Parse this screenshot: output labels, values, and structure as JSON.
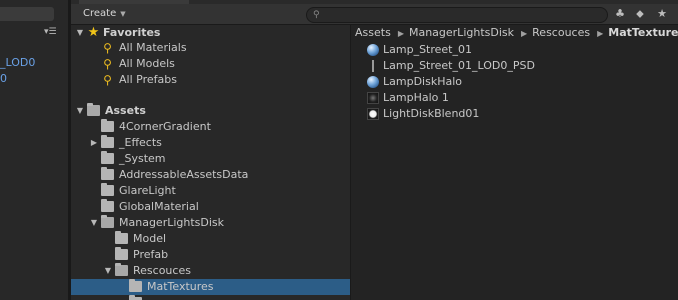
{
  "left_panel": {
    "partial_items": [
      "_LOD0",
      "0"
    ]
  },
  "toolbar": {
    "create_label": "Create"
  },
  "favorites": {
    "title": "Favorites",
    "items": [
      "All Materials",
      "All Models",
      "All Prefabs"
    ]
  },
  "assets_tree": {
    "title": "Assets",
    "items": [
      {
        "label": "4CornerGradient",
        "expanded": false,
        "has_children": false
      },
      {
        "label": "_Effects",
        "expanded": false,
        "has_children": true
      },
      {
        "label": "_System",
        "expanded": false,
        "has_children": false
      },
      {
        "label": "AddressableAssetsData",
        "expanded": false,
        "has_children": false
      },
      {
        "label": "GlareLight",
        "expanded": false,
        "has_children": false
      },
      {
        "label": "GlobalMaterial",
        "expanded": false,
        "has_children": false
      },
      {
        "label": "ManagerLightsDisk",
        "expanded": true,
        "has_children": true
      },
      {
        "label": "Model",
        "expanded": false,
        "has_children": false
      },
      {
        "label": "Prefab",
        "expanded": false,
        "has_children": false
      },
      {
        "label": "Rescouces",
        "expanded": true,
        "has_children": true
      },
      {
        "label": "MatTextures",
        "expanded": false,
        "has_children": false,
        "selected": true
      }
    ]
  },
  "breadcrumb": [
    "Assets",
    "ManagerLightsDisk",
    "Rescouces",
    "MatTextures"
  ],
  "asset_list": [
    {
      "name": "Lamp_Street_01",
      "icon": "material-sphere-icon"
    },
    {
      "name": "Lamp_Street_01_LOD0_PSD",
      "icon": "mesh-icon"
    },
    {
      "name": "LampDiskHalo",
      "icon": "material-sphere-icon"
    },
    {
      "name": "LampHalo 1",
      "icon": "texture-dark-icon"
    },
    {
      "name": "LightDiskBlend01",
      "icon": "texture-white-icon"
    }
  ],
  "colors": {
    "selection": "#2c5d87",
    "link_blue": "#6aa1e6",
    "star": "#f0c419"
  }
}
